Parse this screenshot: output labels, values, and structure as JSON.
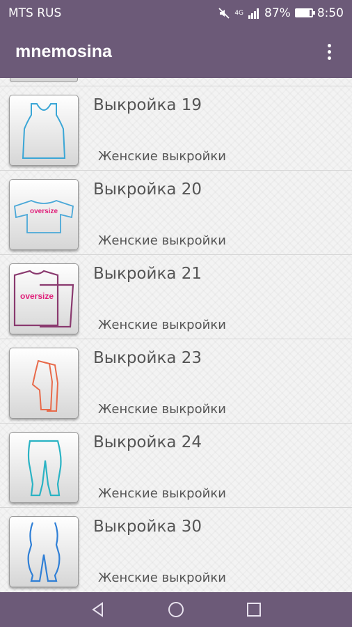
{
  "status_bar": {
    "carrier": "MTS RUS",
    "network": "4G",
    "battery_percent": "87%",
    "battery_level": 0.87,
    "time": "8:50",
    "icons": [
      "mute-icon",
      "signal-icon",
      "battery-icon"
    ]
  },
  "app_bar": {
    "title": "mnemosina",
    "menu_icon": "overflow-menu-icon"
  },
  "items": [
    {
      "title": "Выкройка 19",
      "subtitle": "Женские выкройки",
      "icon": "tank-top-icon",
      "color": "#3aa6d6"
    },
    {
      "title": "Выкройка 20",
      "subtitle": "Женские выкройки",
      "icon": "oversize-tshirt-icon",
      "color": "#4aa8d8",
      "badge": "oversize"
    },
    {
      "title": "Выкройка 21",
      "subtitle": "Женские выкройки",
      "icon": "oversize-top-icon",
      "color": "#8a3a6f",
      "badge": "oversize"
    },
    {
      "title": "Выкройка 23",
      "subtitle": "Женские выкройки",
      "icon": "trousers-pattern-icon",
      "color": "#e86a4a"
    },
    {
      "title": "Выкройка 24",
      "subtitle": "Женские выкройки",
      "icon": "leggings-icon",
      "color": "#2ab3c4"
    },
    {
      "title": "Выкройка 30",
      "subtitle": "Женские выкройки",
      "icon": "body-pants-icon",
      "color": "#2f7fd6"
    }
  ],
  "nav_bar": {
    "back": "back-icon",
    "home": "home-icon",
    "recents": "recents-icon"
  },
  "colors": {
    "primary": "#6c5a78",
    "oversize_text": "#e0207a"
  }
}
